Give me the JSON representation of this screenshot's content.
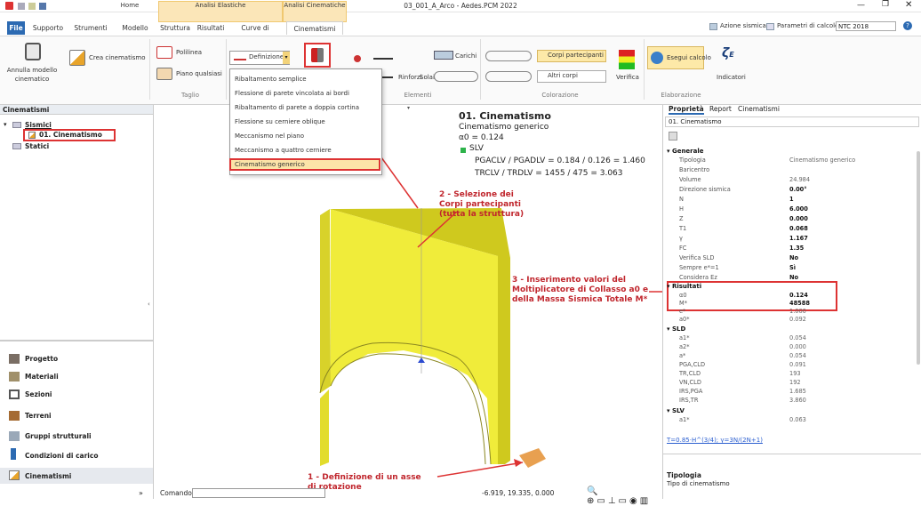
{
  "window": {
    "title": "03_001_A_Arco - Aedes.PCM 2022"
  },
  "tabs": {
    "file": "File",
    "supporto": "Supporto",
    "strumenti": "Strumenti",
    "modello": "Modello",
    "struttura": "Struttura",
    "risultati": "Risultati",
    "curve": "Curve di capacità",
    "cinematismi": "Cinematismi",
    "home": "Home",
    "analisi_elastiche": "Analisi Elastiche",
    "analisi_cinematiche": "Analisi Cinematiche"
  },
  "top_right": {
    "azione_sismica": "Azione sismica",
    "parametri": "Parametri di calcolo",
    "norma": "NTC 2018"
  },
  "ribbon": {
    "annulla": "Annulla modello cinematico",
    "crea": "Crea cinematismo",
    "polilinea": "Polilinea",
    "piano": "Piano qualsiasi",
    "taglio": "Taglio",
    "definizione": "Definizione",
    "rinforzi": "Rinforzi",
    "solai": "Solai",
    "carichi": "Carichi",
    "elementi": "Elementi",
    "corpi": "Corpi partecipanti",
    "altri": "Altri corpi",
    "verifica": "Verifica",
    "colorazione": "Colorazione",
    "esegui": "Esegui calcolo",
    "indicatori": "Indicatori",
    "elaborazione": "Elaborazione"
  },
  "dropdown": {
    "items": [
      "Ribaltamento semplice",
      "Flessione di parete vincolata ai bordi",
      "Ribaltamento di parete a doppia cortina",
      "Flessione su cerniere oblique",
      "Meccanismo nel piano",
      "Meccanismo a quattro cerniere",
      "Cinematismo generico"
    ],
    "selected": "Cinematismo generico"
  },
  "left_panel": {
    "title": "Cinematismi",
    "tree": {
      "sismici": "Sismici",
      "item": "01. Cinematismo",
      "statici": "Statici"
    },
    "nav": [
      "Progetto",
      "Materiali",
      "Sezioni",
      "Terreni",
      "Gruppi strutturali",
      "Condizioni di carico",
      "Cinematismi"
    ]
  },
  "overlay": {
    "title": "01. Cinematismo",
    "subtitle": "Cinematismo generico",
    "a0": "α0 = 0.124",
    "slv": "SLV",
    "pga": "PGACLV / PGADLV = 0.184 / 0.126 = 1.460",
    "tr": "TRCLV / TRDLV = 1455 / 475 = 3.063"
  },
  "annotations": {
    "n1": "1 - Definizione di un asse di rotazione",
    "n2": "2 - Selezione dei Corpi partecipanti (tutta la struttura)",
    "n3": "3 - Inserimento valori del Moltiplicatore di Collasso a0 e della Massa Sismica Totale M*"
  },
  "statusbar": {
    "comando": "Comando",
    "coords": "-6.919, 19.335, 0.000"
  },
  "props": {
    "tab1": "Proprietà",
    "tab2": "Report",
    "tab3": "Cinematismi",
    "header": "01. Cinematismo",
    "generale": "Generale",
    "rows": [
      [
        "Tipologia",
        "Cinematismo generico",
        false
      ],
      [
        "Baricentro",
        "",
        false
      ],
      [
        "Volume",
        "24.984",
        false
      ],
      [
        "Direzione sismica",
        "0.00°",
        true
      ],
      [
        "N",
        "1",
        true
      ],
      [
        "H",
        "6.000",
        true
      ],
      [
        "Z",
        "0.000",
        true
      ],
      [
        "T1",
        "0.068",
        true
      ],
      [
        "γ",
        "1.167",
        true
      ],
      [
        "FC",
        "1.35",
        true
      ],
      [
        "Verifica SLD",
        "No",
        true
      ],
      [
        "Sempre e*=1",
        "Sì",
        true
      ],
      [
        "Considera Ez",
        "No",
        true
      ]
    ],
    "risultati": "Risultati",
    "rrows": [
      [
        "α0",
        "0.124",
        true
      ],
      [
        "M*",
        "48588",
        true
      ],
      [
        "e*",
        "1.000",
        false
      ],
      [
        "a0*",
        "0.092",
        false
      ]
    ],
    "sld": "SLD",
    "srows": [
      [
        "a1*",
        "0.054"
      ],
      [
        "a2*",
        "0.000"
      ],
      [
        "a*",
        "0.054"
      ],
      [
        "PGA,CLD",
        "0.091"
      ],
      [
        "TR,CLD",
        "193"
      ],
      [
        "VN,CLD",
        "192"
      ],
      [
        "IRS,PGA",
        "1.685"
      ],
      [
        "IRS,TR",
        "3.860"
      ]
    ],
    "slv": "SLV",
    "slvrow": [
      "a1*",
      "0.063"
    ],
    "formula": "T=0.85·H^(3/4); γ=3N/(2N+1)",
    "footer_title": "Tipologia",
    "footer_desc": "Tipo di cinematismo"
  }
}
